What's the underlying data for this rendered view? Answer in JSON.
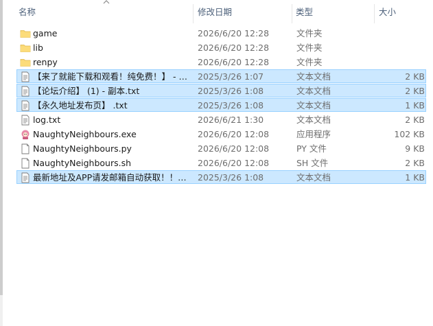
{
  "header": {
    "name": "名称",
    "date": "修改日期",
    "type": "类型",
    "size": "大小"
  },
  "rows": [
    {
      "name": "game",
      "date": "2026/6/20 12:28",
      "type": "文件夹",
      "size": "",
      "icon": "folder-icon",
      "selected": false
    },
    {
      "name": "lib",
      "date": "2026/6/20 12:28",
      "type": "文件夹",
      "size": "",
      "icon": "folder-icon",
      "selected": false
    },
    {
      "name": "renpy",
      "date": "2026/6/20 12:28",
      "type": "文件夹",
      "size": "",
      "icon": "folder-icon",
      "selected": false
    },
    {
      "name": "【来了就能下载和观看！纯免费！】 - 副...",
      "date": "2025/3/26 1:07",
      "type": "文本文档",
      "size": "2 KB",
      "icon": "text-file-icon",
      "selected": true
    },
    {
      "name": "【论坛介绍】 (1) - 副本.txt",
      "date": "2025/3/26 1:08",
      "type": "文本文档",
      "size": "2 KB",
      "icon": "text-file-icon",
      "selected": true
    },
    {
      "name": "【永久地址发布页】 .txt",
      "date": "2025/3/26 1:08",
      "type": "文本文档",
      "size": "1 KB",
      "icon": "text-file-icon",
      "selected": true
    },
    {
      "name": "log.txt",
      "date": "2026/6/21 1:30",
      "type": "文本文档",
      "size": "2 KB",
      "icon": "text-file-icon",
      "selected": false
    },
    {
      "name": "NaughtyNeighbours.exe",
      "date": "2026/6/20 12:08",
      "type": "应用程序",
      "size": "102 KB",
      "icon": "app-icon",
      "selected": false
    },
    {
      "name": "NaughtyNeighbours.py",
      "date": "2026/6/20 12:08",
      "type": "PY 文件",
      "size": "9 KB",
      "icon": "blank-file-icon",
      "selected": false
    },
    {
      "name": "NaughtyNeighbours.sh",
      "date": "2026/6/20 12:08",
      "type": "SH 文件",
      "size": "2 KB",
      "icon": "blank-file-icon",
      "selected": false
    },
    {
      "name": "最新地址及APP请发邮箱自动获取！！！...",
      "date": "2025/3/26 1:08",
      "type": "文本文档",
      "size": "1 KB",
      "icon": "text-file-icon",
      "selected": true
    }
  ]
}
